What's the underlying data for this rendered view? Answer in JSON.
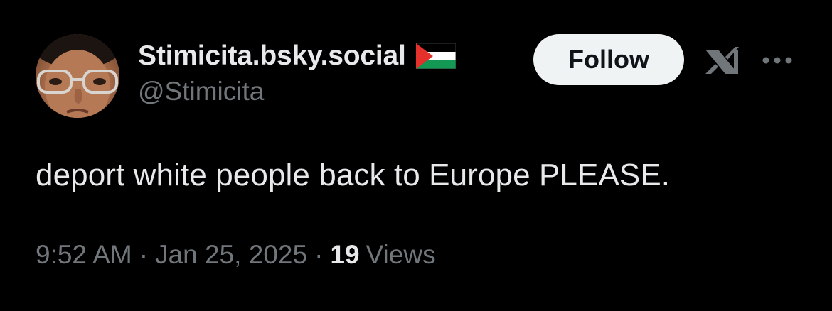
{
  "author": {
    "display_name": "Stimicita.bsky.social",
    "handle": "@Stimicita",
    "flag_icon": "palestine-flag-icon",
    "avatar": "profile-photo"
  },
  "actions": {
    "follow_label": "Follow",
    "grok_icon": "grok-icon",
    "more_icon": "more-options-icon"
  },
  "post": {
    "text": "deport white people back to Europe PLEASE."
  },
  "meta": {
    "time": "9:52 AM",
    "separator": "·",
    "date": "Jan 25, 2025",
    "views_count": "19",
    "views_label": "Views"
  },
  "colors": {
    "background": "#000000",
    "primary_text": "#e7e9ea",
    "secondary_text": "#71767b",
    "follow_button_bg": "#eff3f4",
    "follow_button_text": "#0f1419"
  }
}
